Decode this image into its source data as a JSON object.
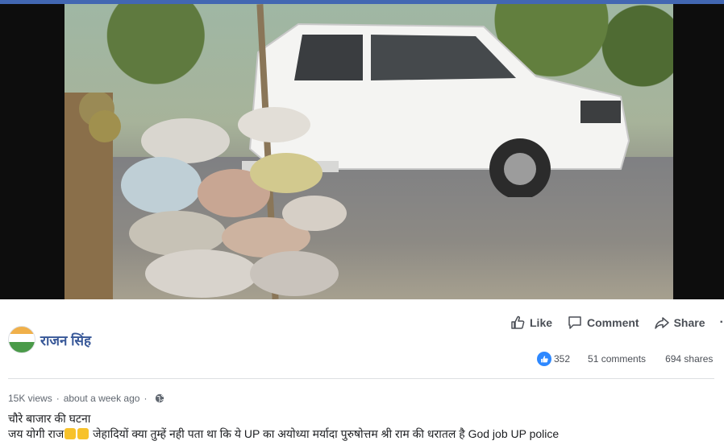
{
  "page": {
    "name": "राजन सिंह"
  },
  "actions": {
    "like": "Like",
    "comment": "Comment",
    "share": "Share",
    "more": "···"
  },
  "stats": {
    "reactions": "352",
    "comments": "51 comments",
    "shares": "694 shares"
  },
  "meta": {
    "views": "15K views",
    "time": "about a week ago"
  },
  "post": {
    "line1": "चौरे बाजार की घटना",
    "line2_a": "जय योगी राज",
    "line2_b": " जेहादियों क्या तुम्हें नही पता था कि ये UP का अयोध्या मर्यादा पुरुषोत्तम श्री राम की धरातल है God job UP police"
  },
  "colors": {
    "brand_blue": "#4267b2",
    "link_blue": "#385898",
    "like_blue": "#2d88ff"
  },
  "icons": {
    "like": "thumbs-up-icon",
    "comment": "speech-bubble-icon",
    "share": "share-arrow-icon",
    "privacy": "globe-icon"
  }
}
